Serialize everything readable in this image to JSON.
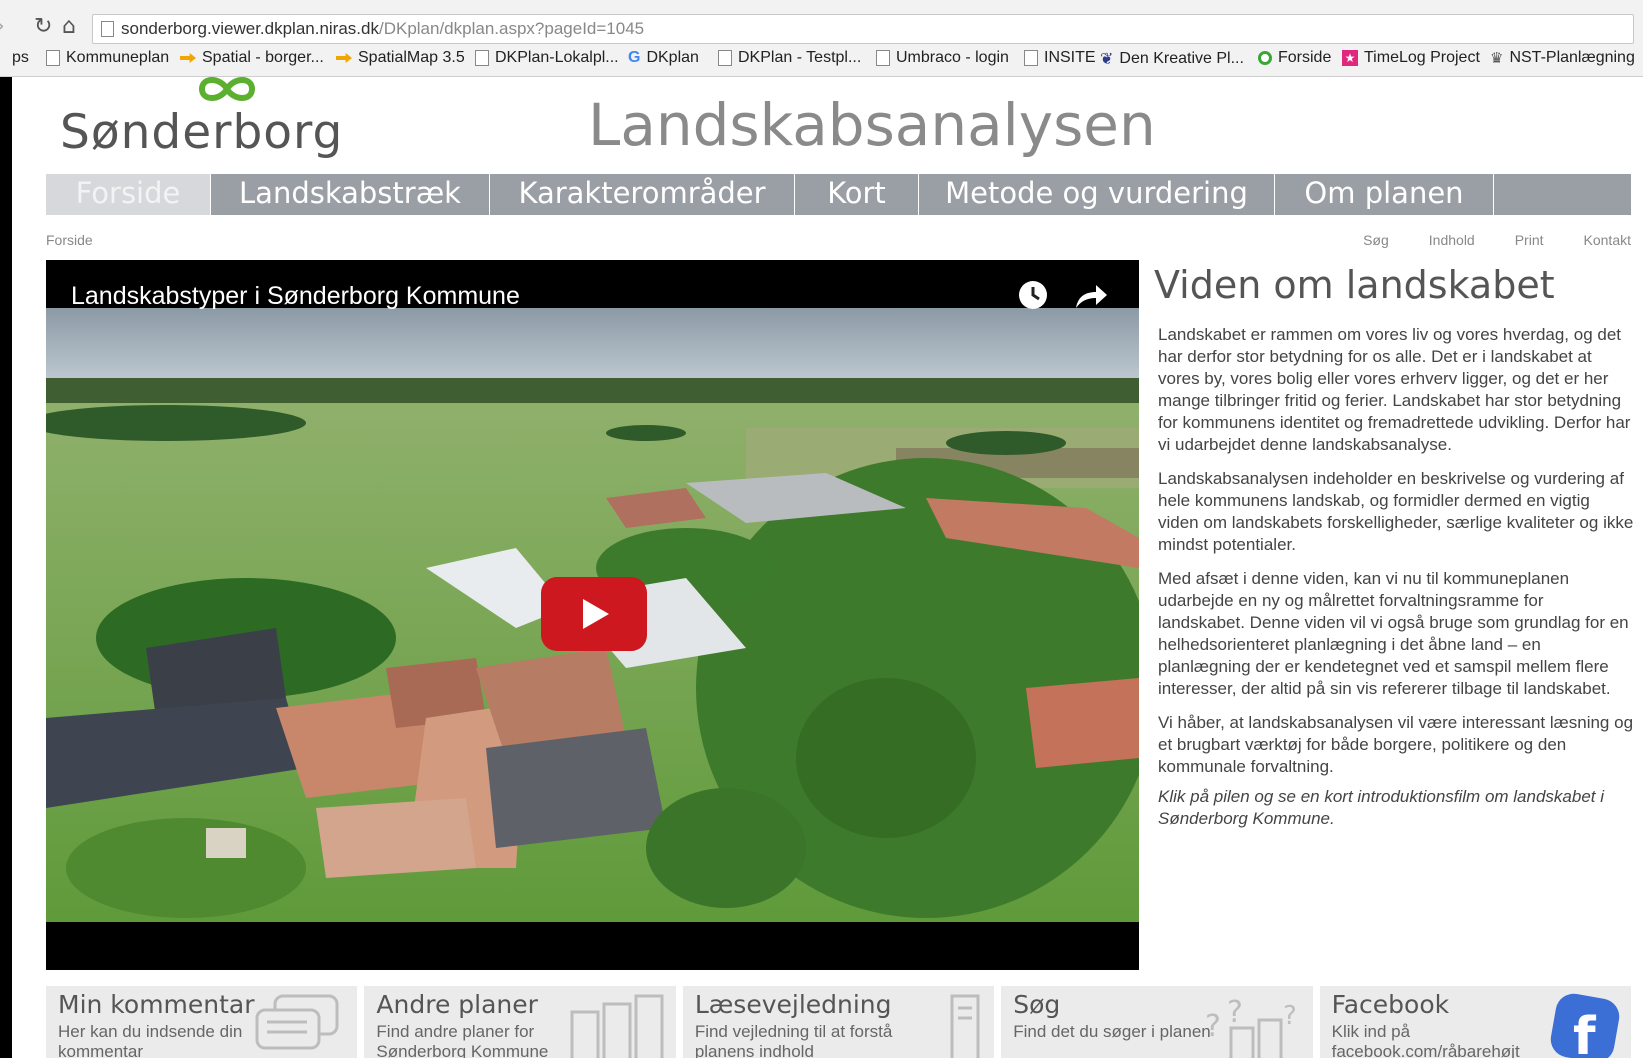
{
  "browser": {
    "url_host": "sonderborg.viewer.dkplan.niras.dk",
    "url_path": "/DKplan/dkplan.aspx?pageId=1045",
    "bookmarks": [
      {
        "label": "ps",
        "icon": "none"
      },
      {
        "label": "Kommuneplan",
        "icon": "page-icon"
      },
      {
        "label": "Spatial - borger...",
        "icon": "arrow-icon"
      },
      {
        "label": "SpatialMap 3.5",
        "icon": "arrow-icon"
      },
      {
        "label": "DKPlan-Lokalpl...",
        "icon": "page-icon"
      },
      {
        "label": "DKplan",
        "icon": "google-icon"
      },
      {
        "label": "DKPlan - Testpl...",
        "icon": "page-icon"
      },
      {
        "label": "Umbraco - login",
        "icon": "page-icon"
      },
      {
        "label": "INSITE",
        "icon": "page-icon"
      },
      {
        "label": "Den Kreative Pl...",
        "icon": "feather-icon"
      },
      {
        "label": "Forside",
        "icon": "circle-icon"
      },
      {
        "label": "TimeLog Project",
        "icon": "star-icon"
      },
      {
        "label": "NST-Planlægning",
        "icon": "crown-icon"
      }
    ]
  },
  "header": {
    "logo_text": "Sønderborg",
    "site_title": "Landskabsanalysen"
  },
  "nav": {
    "items": [
      {
        "label": "Forside",
        "active": true
      },
      {
        "label": "Landskabstræk"
      },
      {
        "label": "Karakterområder"
      },
      {
        "label": "Kort"
      },
      {
        "label": "Metode og vurdering"
      },
      {
        "label": "Om planen"
      }
    ]
  },
  "breadcrumb": "Forside",
  "utility_links": [
    "Søg",
    "Indhold",
    "Print",
    "Kontakt"
  ],
  "video": {
    "title": "Landskabstyper i Sønderborg Kommune",
    "play_icon": "youtube-play-icon",
    "watch_later_icon": "clock-icon",
    "share_icon": "share-arrow-icon"
  },
  "article": {
    "heading": "Viden om landskabet",
    "paragraphs": [
      "Landskabet er rammen om vores liv og vores hverdag, og det har derfor stor betydning for os alle. Det er i landskabet at vores by, vores bolig eller vores erhverv ligger, og det er her mange tilbringer fritid og ferier. Landskabet har stor betydning for kommunens identitet og fremadrettede udvikling. Derfor har vi udarbejdet denne landskabsanalyse.",
      "Landskabsanalysen indeholder en beskrivelse og vurdering af hele kommunens landskab, og formidler dermed en vigtig viden om landskabets forskelligheder, særlige kvaliteter og ikke mindst potentialer.",
      "Med afsæt i denne viden, kan vi nu til kommuneplanen udarbejde en ny og målrettet forvaltningsramme for landskabet. Denne viden vil vi også bruge som grundlag for en helhedsorienteret planlægning i det åbne land – en planlægning der er kendetegnet ved et samspil mellem flere interesser, der altid på sin vis refererer tilbage til landskabet.",
      "Vi håber, at landskabsanalysen vil være interessant læsning og et brugbart værktøj for både borgere, politikere og den kommunale forvaltning."
    ],
    "italic_note": "Klik på pilen og se en kort introduktionsfilm om landskabet i Sønderborg Kommune."
  },
  "tiles": [
    {
      "title": "Min kommentar",
      "sub": "Her kan du indsende din kommentar",
      "icon": "speech-bubbles-icon"
    },
    {
      "title": "Andre planer",
      "sub": "Find andre planer for Sønderborg Kommune",
      "icon": "documents-icon"
    },
    {
      "title": "Læsevejledning",
      "sub": "Find vejledning til at forstå planens indhold",
      "icon": "document-icon"
    },
    {
      "title": "Søg",
      "sub": "Find det du søger i planen",
      "icon": "question-documents-icon"
    },
    {
      "title": "Facebook",
      "sub": "Klik ind på facebook.com/råbarehøjt",
      "icon": "facebook-icon"
    }
  ],
  "colors": {
    "nav_bg": "#9a9ea5",
    "nav_active_bg": "#d6d8db",
    "logo_green": "#5cb030",
    "youtube_red": "#cc181e",
    "facebook_blue": "#3b6fd6",
    "tile_bg": "#ebebeb"
  }
}
